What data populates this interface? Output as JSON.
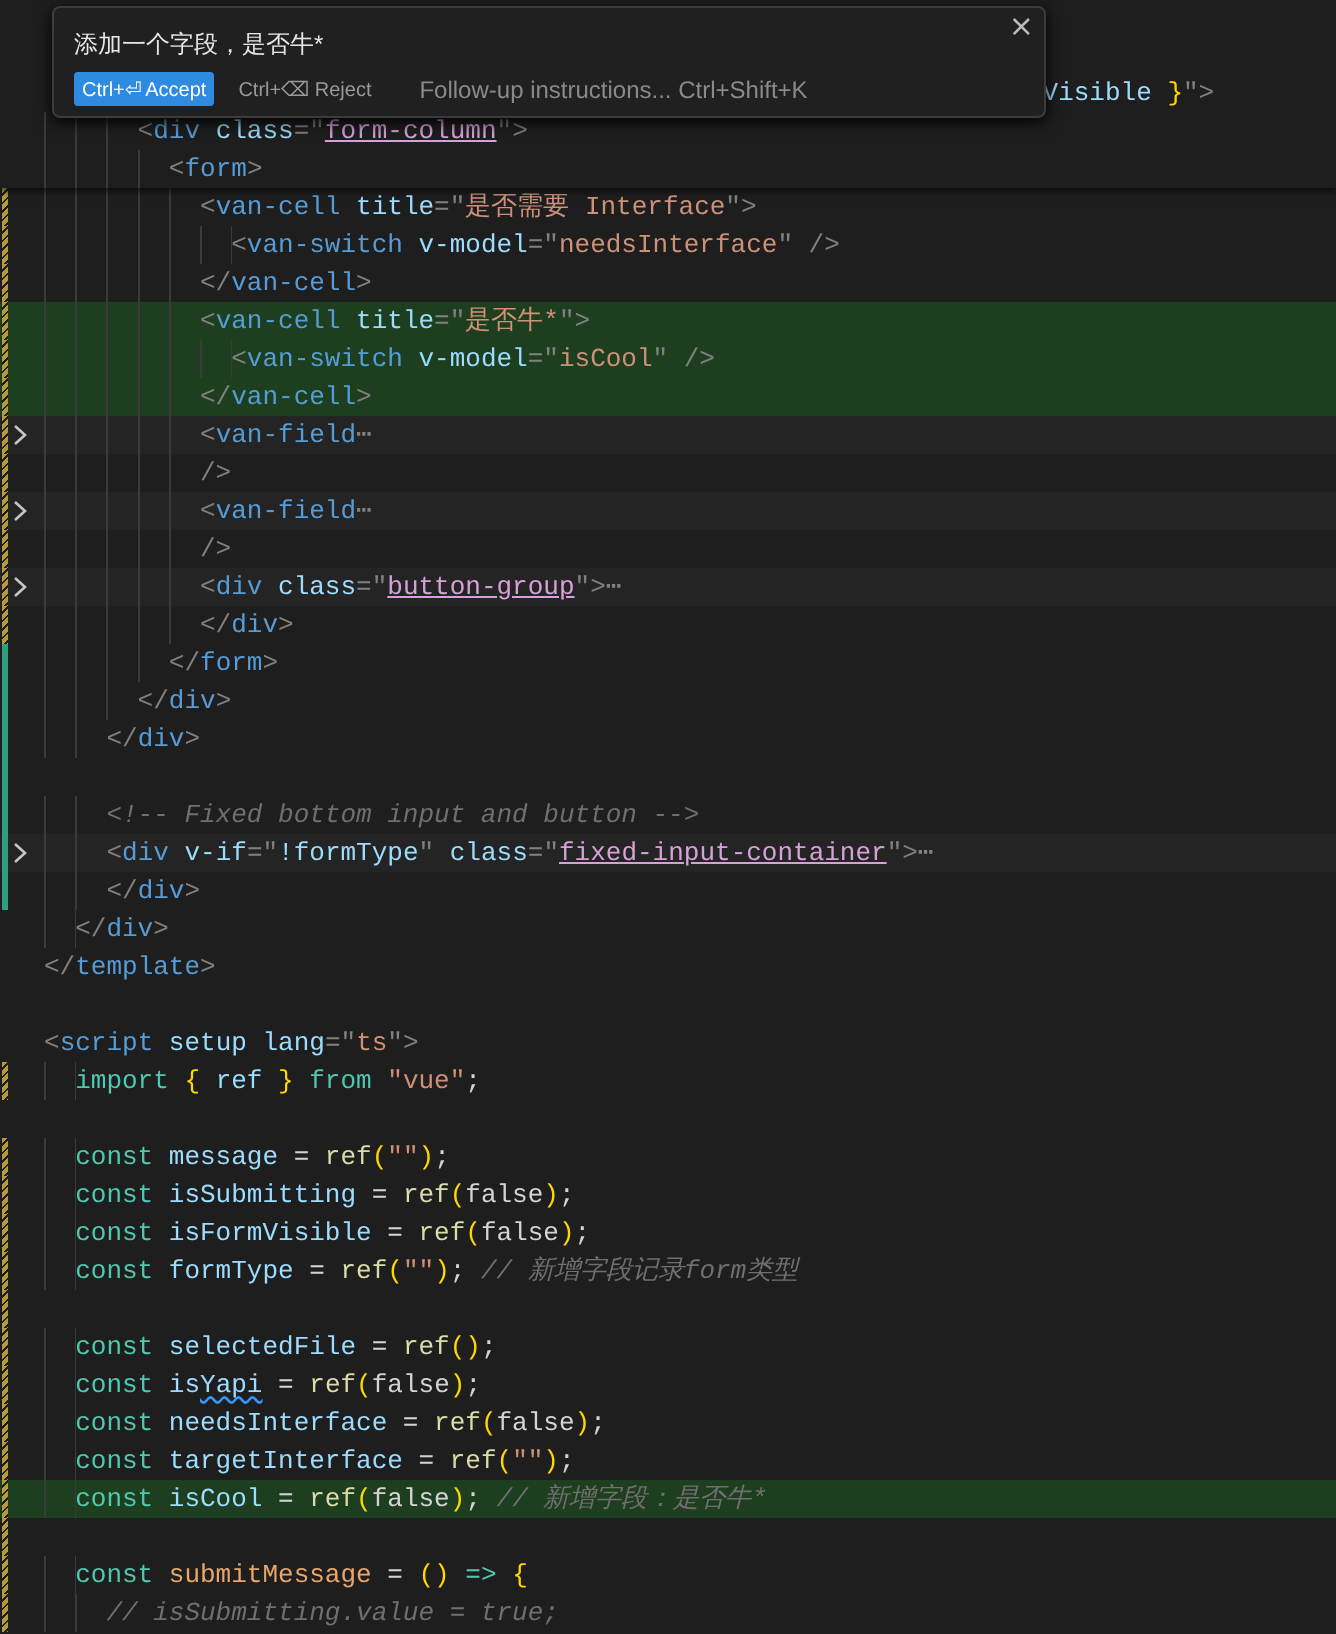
{
  "inline_chat": {
    "title": "添加一个字段，是否牛*",
    "accept": {
      "label": "Ctrl+⏎ Accept"
    },
    "reject": {
      "label": "Ctrl+⌫ Reject"
    },
    "follow_up": {
      "placeholder": "Follow-up instructions... Ctrl+Shift+K"
    },
    "close": "×"
  },
  "sticky_scroll": [
    {
      "added": false,
      "modified": false,
      "folded": false,
      "highlight": false,
      "tokens": [
        {
          "kind": "attr",
          "text": "                                                                Visible"
        },
        {
          "kind": "bracket",
          "text": " }"
        },
        {
          "kind": "punct",
          "text": "\">"
        }
      ]
    },
    {
      "added": false,
      "modified": false,
      "folded": false,
      "highlight": false,
      "tokens": [
        {
          "kind": "punct",
          "text": "      <"
        },
        {
          "kind": "tag",
          "text": "div"
        },
        {
          "kind": "attr",
          "text": " class"
        },
        {
          "kind": "punct",
          "text": "=\""
        },
        {
          "kind": "classname",
          "text": "form-column"
        },
        {
          "kind": "punct",
          "text": "\">"
        }
      ]
    },
    {
      "added": false,
      "modified": false,
      "folded": false,
      "highlight": false,
      "tokens": [
        {
          "kind": "punct",
          "text": "        <"
        },
        {
          "kind": "tag",
          "text": "form"
        },
        {
          "kind": "punct",
          "text": ">"
        }
      ]
    }
  ],
  "lines": [
    {
      "added": false,
      "modified": true,
      "folded": false,
      "highlight": false,
      "tokens": [
        {
          "kind": "punct",
          "text": "          <"
        },
        {
          "kind": "tag",
          "text": "van-cell"
        },
        {
          "kind": "attr",
          "text": " title"
        },
        {
          "kind": "punct",
          "text": "=\""
        },
        {
          "kind": "string",
          "text": "是否需要 Interface"
        },
        {
          "kind": "punct",
          "text": "\">"
        }
      ]
    },
    {
      "added": false,
      "modified": true,
      "folded": false,
      "highlight": false,
      "tokens": [
        {
          "kind": "punct",
          "text": "            <"
        },
        {
          "kind": "tag",
          "text": "van-switch"
        },
        {
          "kind": "attr",
          "text": " v-model"
        },
        {
          "kind": "punct",
          "text": "=\""
        },
        {
          "kind": "string",
          "text": "needsInterface"
        },
        {
          "kind": "punct",
          "text": "\" />"
        }
      ]
    },
    {
      "added": false,
      "modified": true,
      "folded": false,
      "highlight": false,
      "tokens": [
        {
          "kind": "punct",
          "text": "          </"
        },
        {
          "kind": "tag",
          "text": "van-cell"
        },
        {
          "kind": "punct",
          "text": ">"
        }
      ]
    },
    {
      "added": false,
      "modified": true,
      "folded": false,
      "highlight": true,
      "tokens": [
        {
          "kind": "punct",
          "text": "          <"
        },
        {
          "kind": "tag",
          "text": "van-cell"
        },
        {
          "kind": "attr",
          "text": " title"
        },
        {
          "kind": "punct",
          "text": "=\""
        },
        {
          "kind": "string",
          "text": "是否牛*"
        },
        {
          "kind": "punct",
          "text": "\">"
        }
      ]
    },
    {
      "added": false,
      "modified": true,
      "folded": false,
      "highlight": true,
      "tokens": [
        {
          "kind": "punct",
          "text": "            <"
        },
        {
          "kind": "tag",
          "text": "van-switch"
        },
        {
          "kind": "attr",
          "text": " v-model"
        },
        {
          "kind": "punct",
          "text": "=\""
        },
        {
          "kind": "string",
          "text": "isCool"
        },
        {
          "kind": "punct",
          "text": "\" />"
        }
      ]
    },
    {
      "added": false,
      "modified": true,
      "folded": false,
      "highlight": true,
      "tokens": [
        {
          "kind": "punct",
          "text": "          </"
        },
        {
          "kind": "tag",
          "text": "van-cell"
        },
        {
          "kind": "punct",
          "text": ">"
        }
      ]
    },
    {
      "added": false,
      "modified": true,
      "folded": true,
      "highlight": false,
      "tokens": [
        {
          "kind": "punct",
          "text": "          <"
        },
        {
          "kind": "tag",
          "text": "van-field"
        },
        {
          "kind": "punct",
          "text": "⋯"
        }
      ]
    },
    {
      "added": false,
      "modified": true,
      "folded": false,
      "highlight": false,
      "tokens": [
        {
          "kind": "punct",
          "text": "          />"
        }
      ]
    },
    {
      "added": false,
      "modified": true,
      "folded": true,
      "highlight": false,
      "tokens": [
        {
          "kind": "punct",
          "text": "          <"
        },
        {
          "kind": "tag",
          "text": "van-field"
        },
        {
          "kind": "punct",
          "text": "⋯"
        }
      ]
    },
    {
      "added": false,
      "modified": true,
      "folded": false,
      "highlight": false,
      "tokens": [
        {
          "kind": "punct",
          "text": "          />"
        }
      ]
    },
    {
      "added": false,
      "modified": true,
      "folded": true,
      "highlight": false,
      "tokens": [
        {
          "kind": "punct",
          "text": "          <"
        },
        {
          "kind": "tag",
          "text": "div"
        },
        {
          "kind": "attr",
          "text": " class"
        },
        {
          "kind": "punct",
          "text": "=\""
        },
        {
          "kind": "classname",
          "text": "button-group"
        },
        {
          "kind": "punct",
          "text": "\">⋯"
        }
      ]
    },
    {
      "added": false,
      "modified": true,
      "folded": false,
      "highlight": false,
      "tokens": [
        {
          "kind": "punct",
          "text": "          </"
        },
        {
          "kind": "tag",
          "text": "div"
        },
        {
          "kind": "punct",
          "text": ">"
        }
      ]
    },
    {
      "added": true,
      "modified": false,
      "folded": false,
      "highlight": false,
      "tokens": [
        {
          "kind": "punct",
          "text": "        </"
        },
        {
          "kind": "tag",
          "text": "form"
        },
        {
          "kind": "punct",
          "text": ">"
        }
      ]
    },
    {
      "added": true,
      "modified": false,
      "folded": false,
      "highlight": false,
      "tokens": [
        {
          "kind": "punct",
          "text": "      </"
        },
        {
          "kind": "tag",
          "text": "div"
        },
        {
          "kind": "punct",
          "text": ">"
        }
      ]
    },
    {
      "added": true,
      "modified": false,
      "folded": false,
      "highlight": false,
      "tokens": [
        {
          "kind": "punct",
          "text": "    </"
        },
        {
          "kind": "tag",
          "text": "div"
        },
        {
          "kind": "punct",
          "text": ">"
        }
      ]
    },
    {
      "added": true,
      "modified": false,
      "folded": false,
      "highlight": false
    },
    {
      "added": true,
      "modified": false,
      "folded": false,
      "highlight": false,
      "tokens": [
        {
          "kind": "comment",
          "text": "    <!-- Fixed bottom input and button -->"
        }
      ]
    },
    {
      "added": true,
      "modified": false,
      "folded": true,
      "highlight": false,
      "tokens": [
        {
          "kind": "punct",
          "text": "    <"
        },
        {
          "kind": "tag",
          "text": "div"
        },
        {
          "kind": "attr",
          "text": " v-if"
        },
        {
          "kind": "punct",
          "text": "=\""
        },
        {
          "kind": "attr",
          "text": "!formType"
        },
        {
          "kind": "punct",
          "text": "\""
        },
        {
          "kind": "attr",
          "text": " class"
        },
        {
          "kind": "punct",
          "text": "=\""
        },
        {
          "kind": "classname",
          "text": "fixed-input-container"
        },
        {
          "kind": "punct",
          "text": "\">⋯"
        }
      ]
    },
    {
      "added": true,
      "modified": false,
      "folded": false,
      "highlight": false,
      "tokens": [
        {
          "kind": "punct",
          "text": "    </"
        },
        {
          "kind": "tag",
          "text": "div"
        },
        {
          "kind": "punct",
          "text": ">"
        }
      ]
    },
    {
      "added": false,
      "modified": false,
      "folded": false,
      "highlight": false,
      "tokens": [
        {
          "kind": "punct",
          "text": "  </"
        },
        {
          "kind": "tag",
          "text": "div"
        },
        {
          "kind": "punct",
          "text": ">"
        }
      ]
    },
    {
      "added": false,
      "modified": false,
      "folded": false,
      "highlight": false,
      "tokens": [
        {
          "kind": "punct",
          "text": "</"
        },
        {
          "kind": "tag",
          "text": "template"
        },
        {
          "kind": "punct",
          "text": ">"
        }
      ]
    },
    {
      "added": false,
      "modified": false,
      "folded": false,
      "highlight": false
    },
    {
      "added": false,
      "modified": false,
      "folded": false,
      "highlight": false,
      "tokens": [
        {
          "kind": "punct",
          "text": "<"
        },
        {
          "kind": "tag",
          "text": "script"
        },
        {
          "kind": "attr",
          "text": " setup lang"
        },
        {
          "kind": "punct",
          "text": "=\""
        },
        {
          "kind": "string",
          "text": "ts"
        },
        {
          "kind": "punct",
          "text": "\">"
        }
      ]
    },
    {
      "added": false,
      "modified": true,
      "folded": false,
      "highlight": false,
      "tokens": [
        {
          "kind": "keyword",
          "text": "  import "
        },
        {
          "kind": "bracket",
          "text": "{ "
        },
        {
          "kind": "var",
          "text": "ref"
        },
        {
          "kind": "bracket",
          "text": " } "
        },
        {
          "kind": "keyword",
          "text": "from "
        },
        {
          "kind": "string",
          "text": "\"vue\""
        },
        {
          "kind": "plain",
          "text": ";"
        }
      ]
    },
    {
      "added": false,
      "modified": false,
      "folded": false,
      "highlight": false
    },
    {
      "added": false,
      "modified": true,
      "folded": false,
      "highlight": false,
      "tokens": [
        {
          "kind": "keyword",
          "text": "  const "
        },
        {
          "kind": "var",
          "text": "message"
        },
        {
          "kind": "plain",
          "text": " = "
        },
        {
          "kind": "fn",
          "text": "ref"
        },
        {
          "kind": "bracket",
          "text": "("
        },
        {
          "kind": "string",
          "text": "\"\""
        },
        {
          "kind": "bracket",
          "text": ")"
        },
        {
          "kind": "plain",
          "text": ";"
        }
      ]
    },
    {
      "added": false,
      "modified": true,
      "folded": false,
      "highlight": false,
      "tokens": [
        {
          "kind": "keyword",
          "text": "  const "
        },
        {
          "kind": "var",
          "text": "isSubmitting"
        },
        {
          "kind": "plain",
          "text": " = "
        },
        {
          "kind": "fn",
          "text": "ref"
        },
        {
          "kind": "bracket",
          "text": "("
        },
        {
          "kind": "plain",
          "text": "false"
        },
        {
          "kind": "bracket",
          "text": ")"
        },
        {
          "kind": "plain",
          "text": ";"
        }
      ]
    },
    {
      "added": false,
      "modified": true,
      "folded": false,
      "highlight": false,
      "tokens": [
        {
          "kind": "keyword",
          "text": "  const "
        },
        {
          "kind": "var",
          "text": "isFormVisible"
        },
        {
          "kind": "plain",
          "text": " = "
        },
        {
          "kind": "fn",
          "text": "ref"
        },
        {
          "kind": "bracket",
          "text": "("
        },
        {
          "kind": "plain",
          "text": "false"
        },
        {
          "kind": "bracket",
          "text": ")"
        },
        {
          "kind": "plain",
          "text": ";"
        }
      ]
    },
    {
      "added": false,
      "modified": true,
      "folded": false,
      "highlight": false,
      "tokens": [
        {
          "kind": "keyword",
          "text": "  const "
        },
        {
          "kind": "var",
          "text": "formType"
        },
        {
          "kind": "plain",
          "text": " = "
        },
        {
          "kind": "fn",
          "text": "ref"
        },
        {
          "kind": "bracket",
          "text": "("
        },
        {
          "kind": "string",
          "text": "\"\""
        },
        {
          "kind": "bracket",
          "text": ")"
        },
        {
          "kind": "plain",
          "text": "; "
        },
        {
          "kind": "comment",
          "text": "// 新增字段记录form类型"
        }
      ]
    },
    {
      "added": false,
      "modified": true,
      "folded": false,
      "highlight": false
    },
    {
      "added": false,
      "modified": true,
      "folded": false,
      "highlight": false,
      "tokens": [
        {
          "kind": "keyword",
          "text": "  const "
        },
        {
          "kind": "var",
          "text": "selectedFile"
        },
        {
          "kind": "plain",
          "text": " = "
        },
        {
          "kind": "fn",
          "text": "ref"
        },
        {
          "kind": "bracket",
          "text": "()"
        },
        {
          "kind": "plain",
          "text": ";"
        }
      ]
    },
    {
      "added": false,
      "modified": true,
      "folded": false,
      "highlight": false,
      "tokens": [
        {
          "kind": "keyword",
          "text": "  const "
        },
        {
          "kind": "var",
          "text": "is"
        },
        {
          "kind": "spell",
          "text": "Yapi"
        },
        {
          "kind": "plain",
          "text": " = "
        },
        {
          "kind": "fn",
          "text": "ref"
        },
        {
          "kind": "bracket",
          "text": "("
        },
        {
          "kind": "plain",
          "text": "false"
        },
        {
          "kind": "bracket",
          "text": ")"
        },
        {
          "kind": "plain",
          "text": ";"
        }
      ]
    },
    {
      "added": false,
      "modified": true,
      "folded": false,
      "highlight": false,
      "tokens": [
        {
          "kind": "keyword",
          "text": "  const "
        },
        {
          "kind": "var",
          "text": "needsInterface"
        },
        {
          "kind": "plain",
          "text": " = "
        },
        {
          "kind": "fn",
          "text": "ref"
        },
        {
          "kind": "bracket",
          "text": "("
        },
        {
          "kind": "plain",
          "text": "false"
        },
        {
          "kind": "bracket",
          "text": ")"
        },
        {
          "kind": "plain",
          "text": ";"
        }
      ]
    },
    {
      "added": false,
      "modified": true,
      "folded": false,
      "highlight": false,
      "tokens": [
        {
          "kind": "keyword",
          "text": "  const "
        },
        {
          "kind": "var",
          "text": "targetInterface"
        },
        {
          "kind": "plain",
          "text": " = "
        },
        {
          "kind": "fn",
          "text": "ref"
        },
        {
          "kind": "bracket",
          "text": "("
        },
        {
          "kind": "string",
          "text": "\"\""
        },
        {
          "kind": "bracket",
          "text": ")"
        },
        {
          "kind": "plain",
          "text": ";"
        }
      ]
    },
    {
      "added": false,
      "modified": true,
      "folded": false,
      "highlight": true,
      "tokens": [
        {
          "kind": "keyword",
          "text": "  const "
        },
        {
          "kind": "var",
          "text": "isCool"
        },
        {
          "kind": "plain",
          "text": " = "
        },
        {
          "kind": "fn",
          "text": "ref"
        },
        {
          "kind": "bracket",
          "text": "("
        },
        {
          "kind": "plain",
          "text": "false"
        },
        {
          "kind": "bracket",
          "text": ")"
        },
        {
          "kind": "plain",
          "text": "; "
        },
        {
          "kind": "comment",
          "text": "// 新增字段：是否牛*"
        }
      ]
    },
    {
      "added": false,
      "modified": true,
      "folded": false,
      "highlight": false
    },
    {
      "added": false,
      "modified": true,
      "folded": false,
      "highlight": false,
      "tokens": [
        {
          "kind": "keyword",
          "text": "  const "
        },
        {
          "kind": "fndef",
          "text": "submitMessage"
        },
        {
          "kind": "plain",
          "text": " = "
        },
        {
          "kind": "bracket",
          "text": "()"
        },
        {
          "kind": "keyword",
          "text": " => "
        },
        {
          "kind": "bracket",
          "text": "{"
        }
      ]
    },
    {
      "added": false,
      "modified": true,
      "folded": false,
      "highlight": false,
      "tokens": [
        {
          "kind": "comment",
          "text": "    // isSubmitting.value = true;"
        }
      ]
    }
  ]
}
